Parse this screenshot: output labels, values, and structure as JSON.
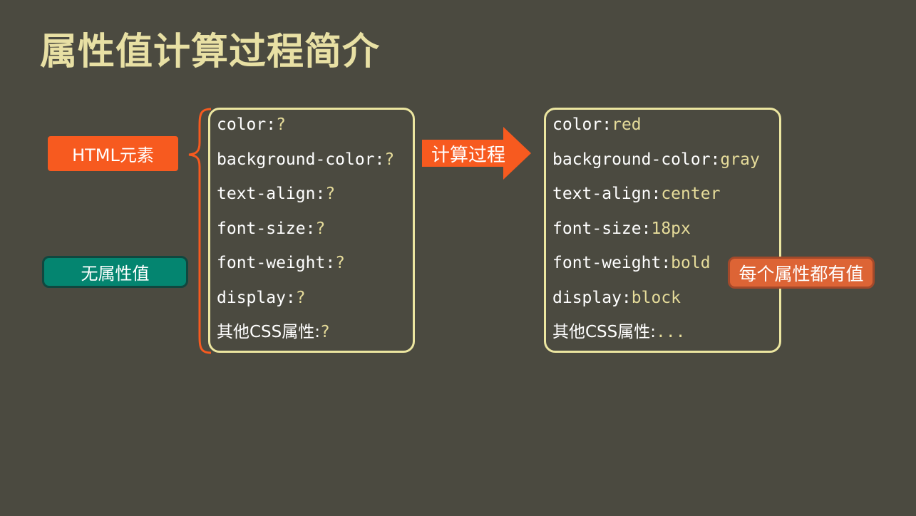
{
  "slide": {
    "title": "属性值计算过程简介",
    "html_element_tag": "HTML元素",
    "no_value_tag": "无属性值",
    "process_label": "计算过程",
    "every_prop_tag": "每个属性都有值"
  },
  "colors": {
    "background": "#4b4a40",
    "title": "#e8e0a4",
    "accent_orange": "#f75a1f",
    "teal": "#048570",
    "box_border": "#ece6a0",
    "value_text": "#e6dc9a"
  },
  "before": [
    {
      "key": "color:",
      "val": "?"
    },
    {
      "key": "background-color:",
      "val": "?"
    },
    {
      "key": "text-align:",
      "val": "?"
    },
    {
      "key": "font-size:",
      "val": "?"
    },
    {
      "key": "font-weight:",
      "val": "?"
    },
    {
      "key": "display:",
      "val": "?"
    },
    {
      "key": "其他CSS属性:",
      "val": "?"
    }
  ],
  "after": [
    {
      "key": "color:",
      "val": "red"
    },
    {
      "key": "background-color:",
      "val": "gray"
    },
    {
      "key": "text-align:",
      "val": "center"
    },
    {
      "key": "font-size:",
      "val": "18px"
    },
    {
      "key": "font-weight:",
      "val": "bold"
    },
    {
      "key": "display:",
      "val": "block"
    },
    {
      "key": "其他CSS属性:",
      "val": "..."
    }
  ]
}
